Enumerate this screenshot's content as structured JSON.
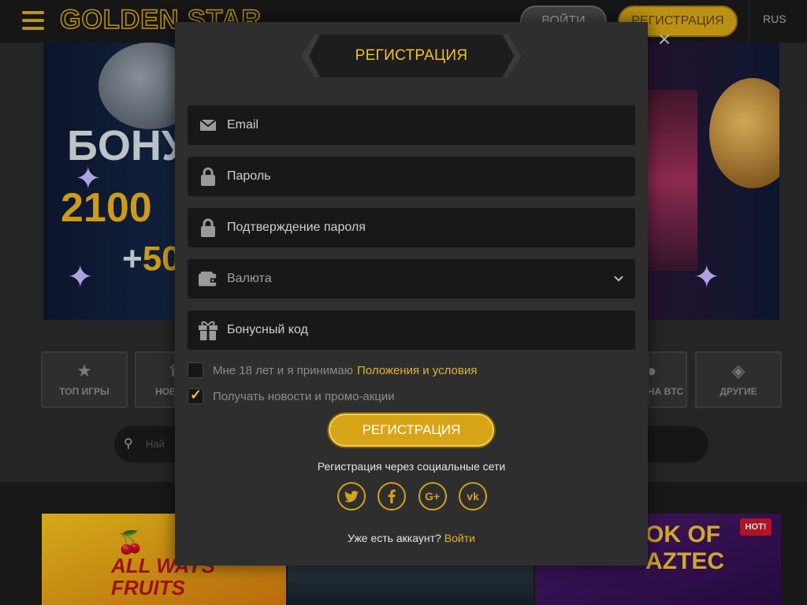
{
  "header": {
    "logo": "GOLDEN STAR",
    "login_label": "ВОЙТИ",
    "register_label": "РЕГИСТРАЦИЯ",
    "language": "RUS"
  },
  "banner": {
    "line1": "БОНУ",
    "line2": "2100",
    "line3_plus": "+",
    "line3_value": "50"
  },
  "categories": [
    {
      "label": "ТОП ИГРЫ",
      "icon": "star-icon"
    },
    {
      "label": "НОВ",
      "icon": "crown-icon"
    },
    {
      "label": "НА BTC",
      "icon": "bitcoin-icon"
    },
    {
      "label": "ДРУГИЕ",
      "icon": "cube-icon"
    }
  ],
  "search": {
    "placeholder": "Най"
  },
  "games": [
    {
      "title": "ALL WAYS FRUITS"
    },
    {
      "title": ""
    },
    {
      "title": "OK OF AZTEC",
      "badge": "HOT!"
    }
  ],
  "modal": {
    "title": "РЕГИСТРАЦИЯ",
    "fields": {
      "email": {
        "placeholder": "Email",
        "icon": "envelope-icon"
      },
      "password": {
        "placeholder": "Пароль",
        "icon": "lock-icon"
      },
      "password_confirm": {
        "placeholder": "Подтверждение пароля",
        "icon": "lock-icon"
      },
      "currency": {
        "placeholder": "Валюта",
        "icon": "wallet-icon"
      },
      "bonus_code": {
        "placeholder": "Бонусный код",
        "icon": "gift-icon"
      }
    },
    "age_checkbox": {
      "text": "Мне 18 лет и я принимаю",
      "link": "Положения и условия",
      "checked": false
    },
    "news_checkbox": {
      "text": "Получать новости и промо-акции",
      "checked": true
    },
    "submit_label": "РЕГИСТРАЦИЯ",
    "social_caption": "Регистрация через социальные сети",
    "socials": [
      {
        "name": "twitter",
        "glyph": "t"
      },
      {
        "name": "facebook",
        "glyph": "f"
      },
      {
        "name": "google-plus",
        "glyph": "G+"
      },
      {
        "name": "vk",
        "glyph": "vk"
      }
    ],
    "account_question": "Уже есть аккаунт?",
    "account_login": "Войти"
  },
  "colors": {
    "accent": "#d7a517",
    "accent_text": "#f0c12b",
    "modal_bg": "#2e2e2e",
    "field_bg": "#181818"
  }
}
